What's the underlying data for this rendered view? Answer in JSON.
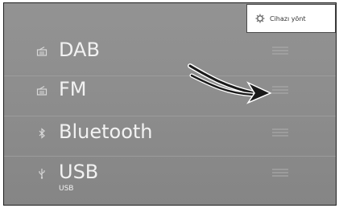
{
  "manage_button": {
    "label": "Cihazı yönt",
    "icon": "gear-icon"
  },
  "sources": [
    {
      "label": "DAB",
      "sub": "",
      "icon": "radio-icon"
    },
    {
      "label": "FM",
      "sub": "",
      "icon": "radio-icon"
    },
    {
      "label": "Bluetooth",
      "sub": "",
      "icon": "bluetooth-icon"
    },
    {
      "label": "USB",
      "sub": "USB",
      "icon": "usb-icon"
    }
  ],
  "colors": {
    "background": "#8e8e8e",
    "text": "#f2f2f2",
    "handle": "#a9a9a9",
    "arrow": "#1a1a1a"
  }
}
